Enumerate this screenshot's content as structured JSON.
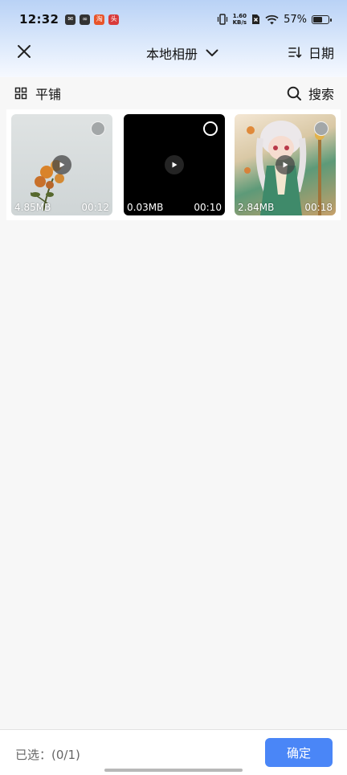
{
  "status": {
    "time": "12:32",
    "net_speed_value": "1.60",
    "net_speed_unit": "KB/s",
    "battery_pct": "57%",
    "battery_level": 0.57
  },
  "toolbar": {
    "album_title": "本地相册",
    "sort_label": "日期"
  },
  "viewbar": {
    "layout_label": "平铺",
    "search_label": "搜索"
  },
  "media": [
    {
      "size": "4.85MB",
      "duration": "00:12",
      "selected": false
    },
    {
      "size": "0.03MB",
      "duration": "00:10",
      "selected": false
    },
    {
      "size": "2.84MB",
      "duration": "00:18",
      "selected": false
    }
  ],
  "footer": {
    "selected_text": "已选：(0/1)",
    "confirm_label": "确定"
  },
  "colors": {
    "accent": "#4a86f7",
    "header_gradient_top": "#b9d2f6"
  }
}
